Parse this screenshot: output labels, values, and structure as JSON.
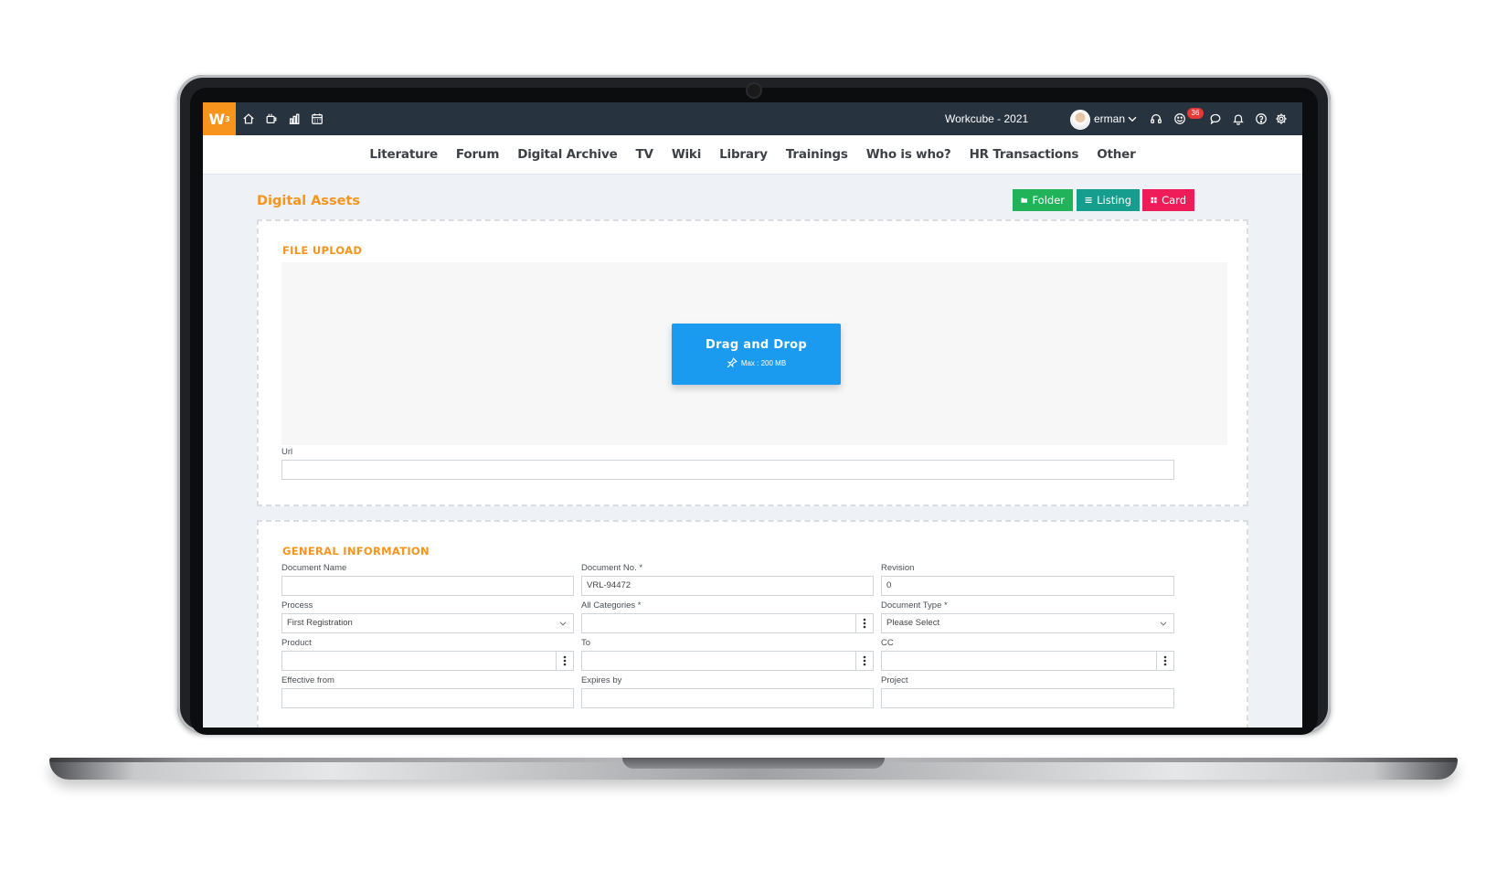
{
  "topbar": {
    "logo": "W",
    "logo_sup": "3",
    "left_icons": [
      "home-icon",
      "cup-icon",
      "bar-chart-icon",
      "calendar-icon"
    ],
    "workspace": "Workcube - 2021",
    "user": "erman",
    "notification_count": "36",
    "right_icons": [
      "headset-icon",
      "smile-icon",
      "chat-icon",
      "bell-icon",
      "help-icon",
      "gear-icon"
    ]
  },
  "nav": {
    "items": [
      "Literature",
      "Forum",
      "Digital Archive",
      "TV",
      "Wiki",
      "Library",
      "Trainings",
      "Who is who?",
      "HR Transactions",
      "Other"
    ]
  },
  "page": {
    "title": "Digital Assets",
    "views": {
      "folder": "Folder",
      "listing": "Listing",
      "card": "Card"
    }
  },
  "upload": {
    "section_title": "FILE UPLOAD",
    "drag_title": "Drag and Drop",
    "drag_max": "Max : 200 MB",
    "url_label": "Url",
    "url_value": ""
  },
  "general": {
    "section_title": "GENERAL INFORMATION",
    "fields": {
      "document_name": {
        "label": "Document Name",
        "value": ""
      },
      "document_no": {
        "label": "Document No. *",
        "value": "VRL-94472"
      },
      "revision": {
        "label": "Revision",
        "value": "0"
      },
      "process": {
        "label": "Process",
        "value": "First Registration"
      },
      "all_categories": {
        "label": "All Categories *",
        "value": ""
      },
      "document_type": {
        "label": "Document Type *",
        "value": "Please Select"
      },
      "product": {
        "label": "Product",
        "value": ""
      },
      "to": {
        "label": "To",
        "value": ""
      },
      "cc": {
        "label": "CC",
        "value": ""
      },
      "effective_from": {
        "label": "Effective from"
      },
      "expires_by": {
        "label": "Expires by"
      },
      "project": {
        "label": "Project"
      }
    }
  },
  "colors": {
    "accent": "#f7941d",
    "topbar": "#283340",
    "folder_btn": "#21b35a",
    "listing_btn": "#159d8d",
    "card_btn": "#ee1c59",
    "drag_btn": "#1a9bf0",
    "badge": "#e53935"
  }
}
